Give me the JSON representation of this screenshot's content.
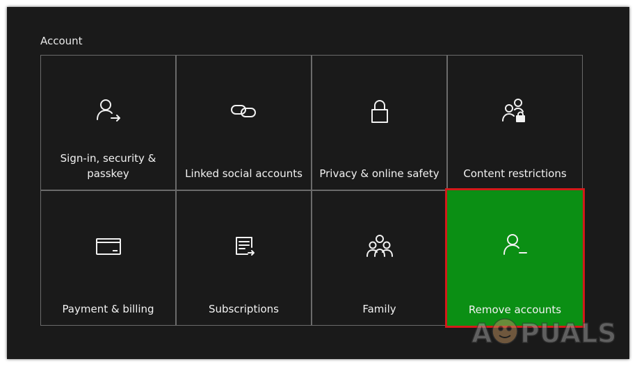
{
  "section_title": "Account",
  "tiles": [
    {
      "label": "Sign-in, security & passkey",
      "icon": "user-arrow-icon"
    },
    {
      "label": "Linked social accounts",
      "icon": "link-icon"
    },
    {
      "label": "Privacy & online safety",
      "icon": "lock-icon"
    },
    {
      "label": "Content restrictions",
      "icon": "users-lock-icon"
    },
    {
      "label": "Payment & billing",
      "icon": "credit-card-icon"
    },
    {
      "label": "Subscriptions",
      "icon": "subscription-list-icon"
    },
    {
      "label": "Family",
      "icon": "family-icon"
    },
    {
      "label": "Remove accounts",
      "icon": "user-remove-icon"
    }
  ],
  "selected_tile": "Remove accounts",
  "watermark": "APPUALS",
  "colors": {
    "background": "#1a1a1a",
    "tile_border": "#6b6b6b",
    "selected_fill": "#0b8f14",
    "highlight_outline": "#d31a1a",
    "text": "#f2f2f2"
  }
}
